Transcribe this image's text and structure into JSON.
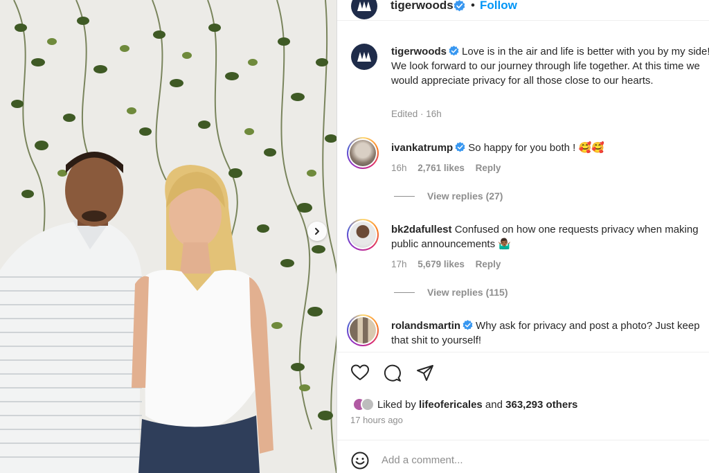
{
  "post": {
    "author": "tigerwoods",
    "follow_label": "Follow",
    "dot": "•",
    "caption": "Love is in the air and life is better with you by my side! We look forward to our journey through life together. At this time we would appreciate privacy for all those close to our hearts.",
    "caption_meta": "Edited · 16h",
    "logo_text": "TGR"
  },
  "comments": [
    {
      "user": "ivankatrump",
      "verified": true,
      "text": "So happy for you both ! 🥰🥰",
      "time": "16h",
      "likes": "2,761 likes",
      "reply_label": "Reply",
      "view_replies": "View replies (27)"
    },
    {
      "user": "bk2dafullest",
      "verified": false,
      "text": "Confused on how one requests privacy when making public announcements 🤷🏾‍♂️",
      "time": "17h",
      "likes": "5,679 likes",
      "reply_label": "Reply",
      "view_replies": "View replies (115)"
    },
    {
      "user": "rolandsmartin",
      "verified": true,
      "text": "Why ask for privacy and post a photo? Just keep that shit to yourself!"
    }
  ],
  "engagement": {
    "liked_by_prefix": "Liked by ",
    "liked_by_user": "lifeofericales",
    "liked_by_and": " and ",
    "liked_by_count": "363,293 others",
    "timestamp": "17 hours ago"
  },
  "comment_box": {
    "placeholder": "Add a comment..."
  },
  "icons": {
    "like": "heart-icon",
    "comment": "comment-bubble-icon",
    "share": "paper-plane-icon",
    "emoji": "smiley-icon",
    "verified": "verified-badge-icon",
    "carousel_next": "chevron-right-icon"
  },
  "colors": {
    "accent": "#0095f6",
    "verified": "#3897f0",
    "muted_text": "#8e8e8e",
    "text": "#262626",
    "border": "#dbdbdb"
  }
}
